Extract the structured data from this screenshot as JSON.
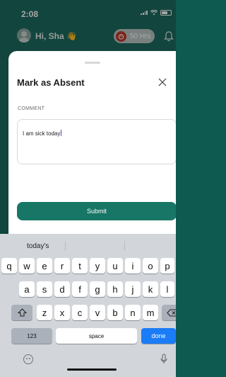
{
  "status_bar": {
    "time": "2:08"
  },
  "header": {
    "greeting": "Hi, Sha",
    "wave_emoji": "👋",
    "hours_label": "50 Hrs"
  },
  "sheet": {
    "title": "Mark as Absent",
    "comment_label": "COMMENT",
    "comment_value": "I am sick today",
    "submit_label": "Submit"
  },
  "keyboard": {
    "suggestion": "today's",
    "row1": [
      "q",
      "w",
      "e",
      "r",
      "t",
      "y",
      "u",
      "i",
      "o",
      "p"
    ],
    "row2": [
      "a",
      "s",
      "d",
      "f",
      "g",
      "h",
      "j",
      "k",
      "l"
    ],
    "row3": [
      "z",
      "x",
      "c",
      "v",
      "b",
      "n",
      "m"
    ],
    "numbers_label": "123",
    "space_label": "space",
    "done_label": "done"
  },
  "icons": [
    "signal-icon",
    "wifi-icon",
    "battery-icon",
    "avatar",
    "timer-icon",
    "bell-icon",
    "close-icon",
    "shift-icon",
    "backspace-icon",
    "emoji-icon",
    "mic-icon"
  ]
}
